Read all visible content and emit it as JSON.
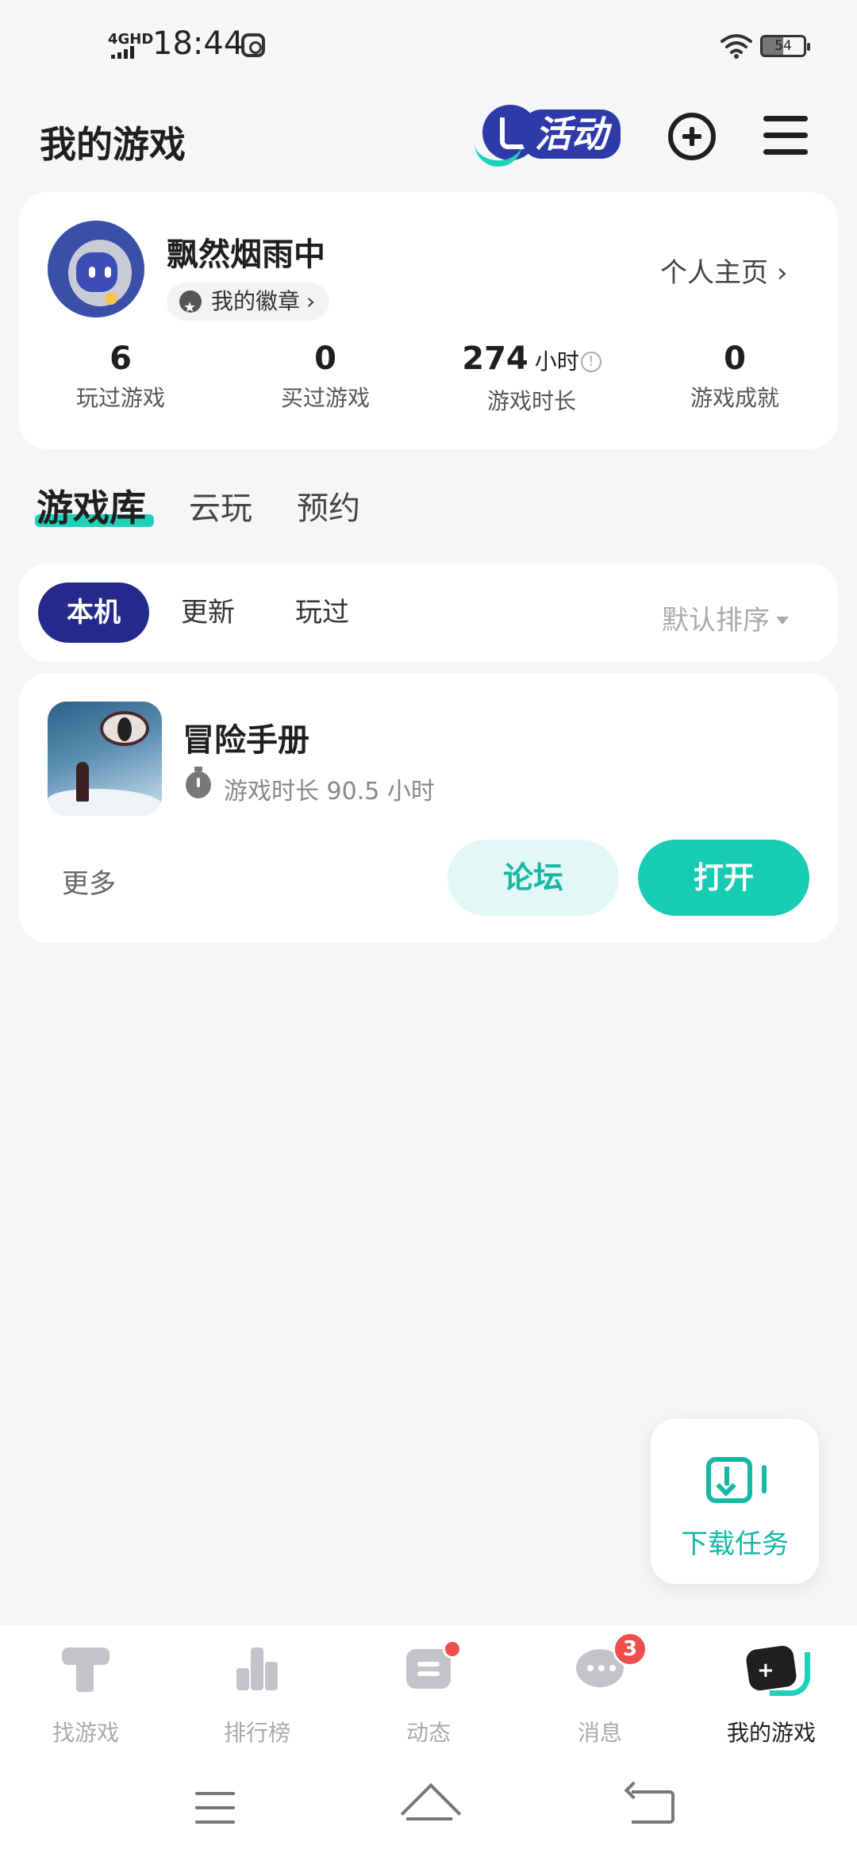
{
  "status_bar": {
    "network": "4GHD",
    "time": "18:44",
    "battery": "54"
  },
  "header": {
    "title": "我的游戏",
    "activity_label": "活动"
  },
  "profile": {
    "username": "飘然烟雨中",
    "badges_label": "我的徽章",
    "homepage_label": "个人主页",
    "stats": [
      {
        "value": "6",
        "unit": "",
        "label": "玩过游戏"
      },
      {
        "value": "0",
        "unit": "",
        "label": "买过游戏"
      },
      {
        "value": "274",
        "unit": "小时",
        "label": "游戏时长"
      },
      {
        "value": "0",
        "unit": "",
        "label": "游戏成就"
      }
    ]
  },
  "library_tabs": [
    {
      "label": "游戏库",
      "active": true
    },
    {
      "label": "云玩",
      "active": false
    },
    {
      "label": "预约",
      "active": false
    }
  ],
  "filters": {
    "chips": [
      {
        "label": "本机",
        "active": true
      },
      {
        "label": "更新",
        "active": false
      },
      {
        "label": "玩过",
        "active": false
      }
    ],
    "sort_label": "默认排序"
  },
  "games": [
    {
      "name": "冒险手册",
      "playtime": "游戏时长 90.5 小时",
      "more_label": "更多",
      "forum_label": "论坛",
      "open_label": "打开"
    }
  ],
  "download_fab": {
    "label": "下载任务"
  },
  "bottom_nav": {
    "items": [
      {
        "label": "找游戏",
        "icon": "find-games-icon"
      },
      {
        "label": "排行榜",
        "icon": "ranking-icon"
      },
      {
        "label": "动态",
        "icon": "feed-icon"
      },
      {
        "label": "消息",
        "icon": "message-icon",
        "badge": "3"
      },
      {
        "label": "我的游戏",
        "icon": "my-games-icon",
        "active": true
      }
    ]
  },
  "colors": {
    "accent": "#16cdb4",
    "brand_navy": "#232a8c",
    "badge_red": "#f04d4d"
  }
}
